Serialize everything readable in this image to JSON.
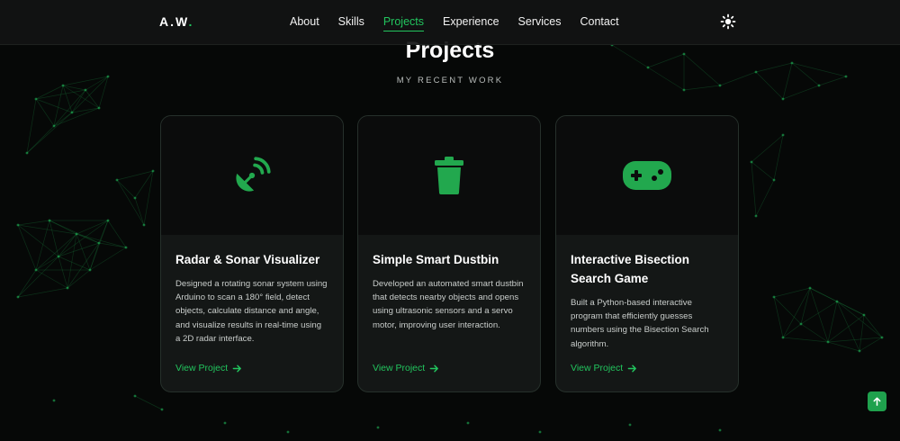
{
  "nav": {
    "logo_text": "A.W",
    "logo_dot": ".",
    "links": [
      "About",
      "Skills",
      "Projects",
      "Experience",
      "Services",
      "Contact"
    ],
    "active_link": "Projects",
    "theme_toggle_icon": "sun-icon"
  },
  "section": {
    "title": "Projects",
    "subtitle": "MY RECENT WORK"
  },
  "projects": [
    {
      "icon": "satellite-dish-icon",
      "title": "Radar & Sonar Visualizer",
      "description": "Designed a rotating sonar system using Arduino to scan a 180° field, detect objects, calculate distance and angle, and visualize results in real-time using a 2D radar interface.",
      "link": "View Project"
    },
    {
      "icon": "trash-can-icon",
      "title": "Simple Smart Dustbin",
      "description": "Developed an automated smart dustbin that detects nearby objects and opens using ultrasonic sensors and a servo motor, improving user interaction.",
      "link": "View Project"
    },
    {
      "icon": "gamepad-icon",
      "title": "Interactive Bisection Search Game",
      "description": "Built a Python-based interactive program that efficiently guesses numbers using the Bisection Search algorithm.",
      "link": "View Project"
    }
  ],
  "scroll_top_icon": "arrow-up-icon",
  "colors": {
    "accent": "#22c55e",
    "background": "#060807",
    "card": "#141716",
    "card_media": "#0b0c0c",
    "nav": "#121413"
  }
}
